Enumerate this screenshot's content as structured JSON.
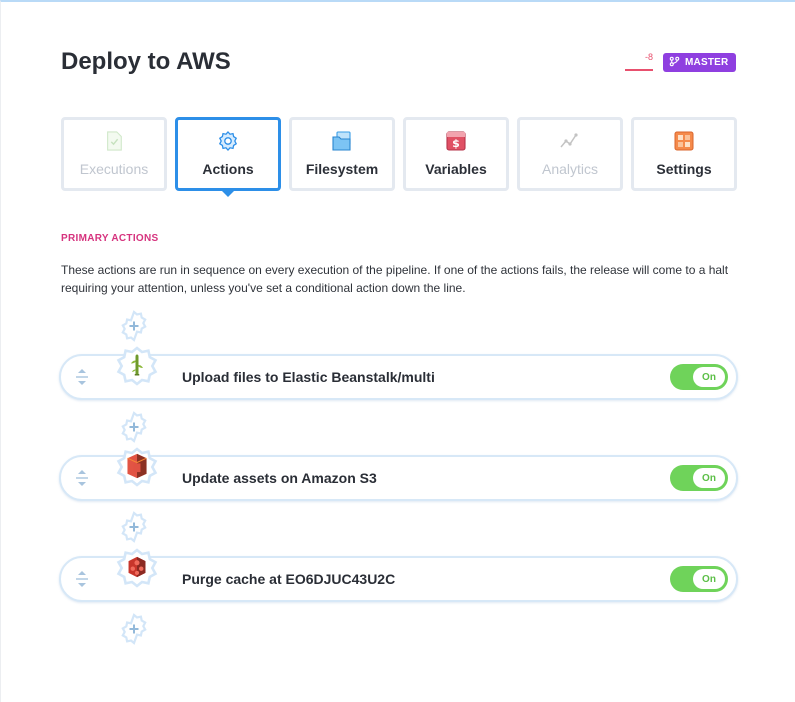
{
  "page": {
    "title": "Deploy to AWS"
  },
  "header": {
    "sparkline_value": "-8",
    "branch_label": "MASTER",
    "colors": {
      "branch": "#8f3fe0",
      "sparkline": "#e8506e"
    }
  },
  "tabs": [
    {
      "label": "Executions",
      "icon": "document-check-icon",
      "state": "disabled"
    },
    {
      "label": "Actions",
      "icon": "gear-icon",
      "state": "active"
    },
    {
      "label": "Filesystem",
      "icon": "folder-icon",
      "state": "normal"
    },
    {
      "label": "Variables",
      "icon": "dollar-sign-icon",
      "state": "normal"
    },
    {
      "label": "Analytics",
      "icon": "line-chart-icon",
      "state": "disabled"
    },
    {
      "label": "Settings",
      "icon": "grid-tiles-icon",
      "state": "normal"
    }
  ],
  "primary_actions": {
    "section_label": "PRIMARY ACTIONS",
    "description": "These actions are run in sequence on every execution of the pipeline. If one of the actions fails, the release will come to a halt requiring your attention, unless you've set a conditional action down the line.",
    "actions": [
      {
        "name": "Upload files to Elastic Beanstalk/multi",
        "icon": "elastic-beanstalk-icon",
        "toggle": "On"
      },
      {
        "name": "Update assets on Amazon S3",
        "icon": "amazon-s3-icon",
        "toggle": "On"
      },
      {
        "name": "Purge cache at EO6DJUC43U2C",
        "icon": "cloudfront-icon",
        "toggle": "On"
      }
    ]
  },
  "colors": {
    "accent": "#2d8fe8",
    "toggle_on": "#6fd35a",
    "section_label": "#d6337e"
  }
}
